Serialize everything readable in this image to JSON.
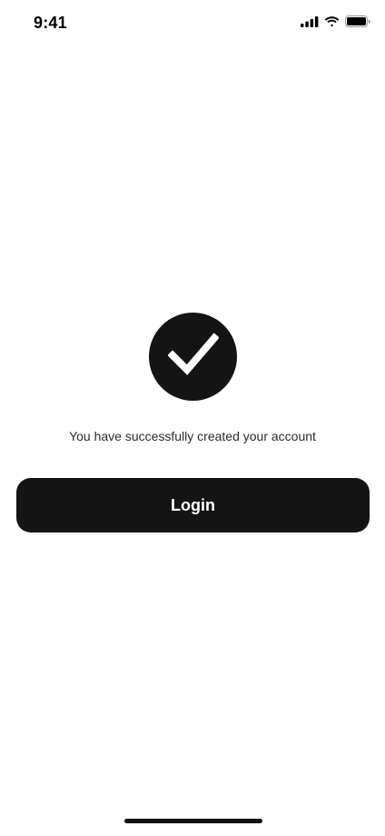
{
  "status_bar": {
    "time": "9:41",
    "icons": [
      "cellular-signal-icon",
      "wifi-icon",
      "battery-icon"
    ]
  },
  "success": {
    "icon": "checkmark-icon",
    "message": "You have successfully created your account"
  },
  "actions": {
    "login_label": "Login"
  },
  "colors": {
    "background": "#ffffff",
    "primary": "#141414",
    "on_primary": "#ffffff",
    "text": "#2b2b2b"
  }
}
